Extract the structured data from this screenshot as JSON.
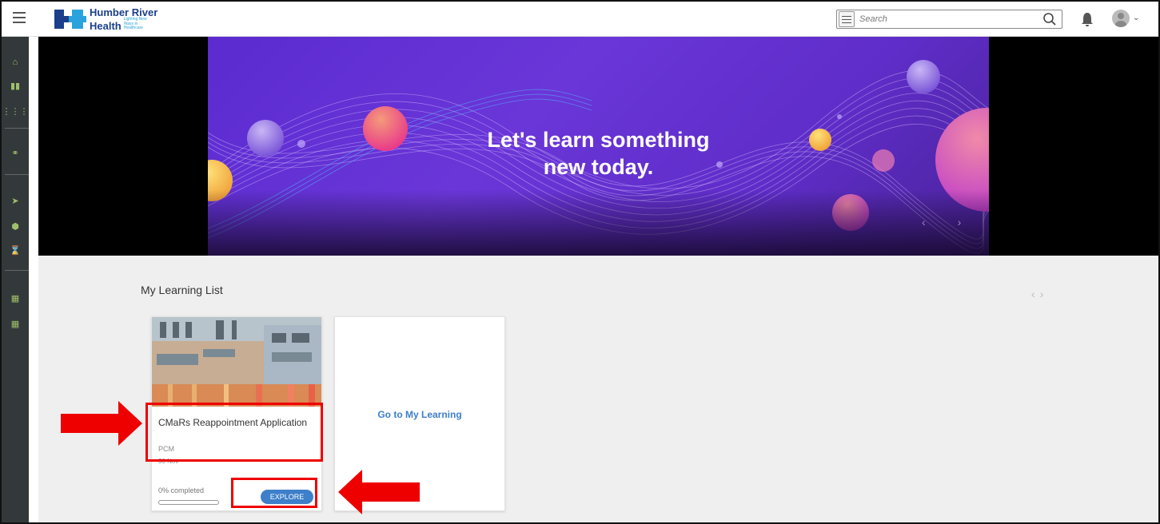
{
  "header": {
    "logo_line1": "Humber River",
    "logo_line2": "Health",
    "logo_tagline": "Lighting New Ways in Healthcare",
    "search_placeholder": "Search"
  },
  "hero": {
    "headline_line1": "Let's learn something",
    "headline_line2": "new today."
  },
  "learning_list": {
    "title": "My Learning List",
    "cards": [
      {
        "title": "CMaRs Reappointment Application",
        "subtitle": "PCM",
        "date": "30 Nov",
        "progress_label": "0% completed",
        "progress": 0,
        "button_label": "EXPLORE"
      }
    ],
    "go_to_label": "Go to My Learning"
  },
  "colors": {
    "accent": "#3d7fc9",
    "sidebar": "#33393a",
    "annotation": "#e00000",
    "brand_dark": "#1b3f8b",
    "brand_light": "#2aa3dc"
  },
  "icons": {
    "sidebar": [
      "home-icon",
      "book-icon",
      "grid-icon",
      "globe-icon",
      "send-icon",
      "hexagon-icon",
      "hourglass-icon",
      "calendar-icon",
      "calendar-icon-2"
    ]
  }
}
